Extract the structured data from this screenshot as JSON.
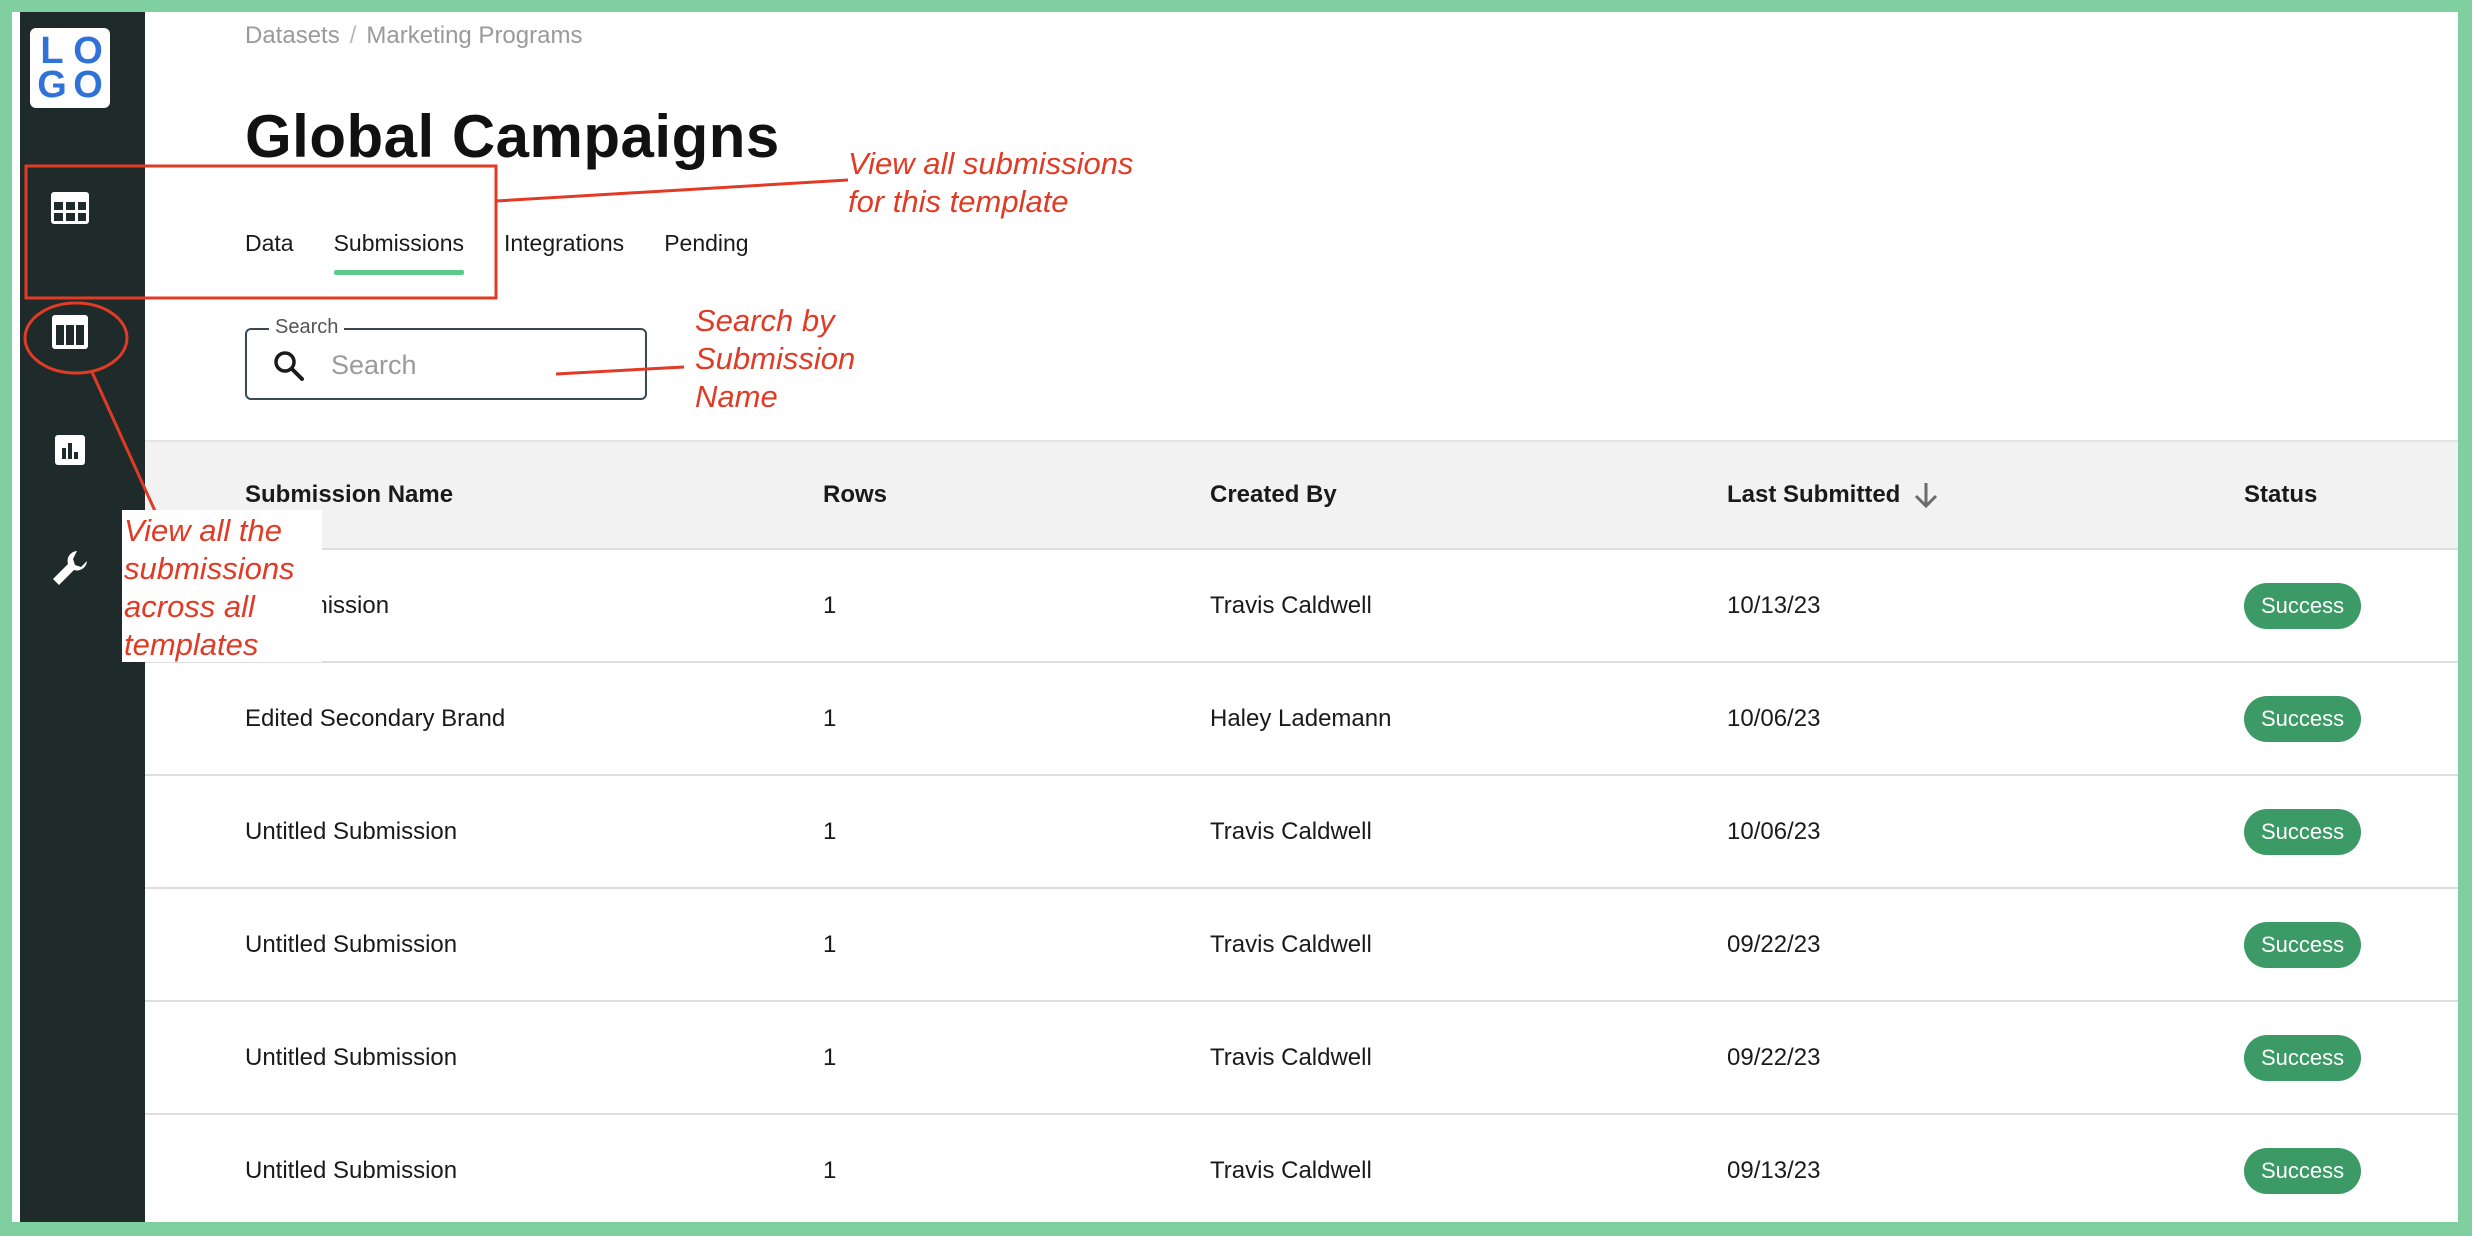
{
  "breadcrumb": {
    "items": [
      "Datasets",
      "Marketing Programs"
    ],
    "separator": "/"
  },
  "page_title": "Global Campaigns",
  "tabs": [
    {
      "label": "Data",
      "active": false
    },
    {
      "label": "Submissions",
      "active": true
    },
    {
      "label": "Integrations",
      "active": false
    },
    {
      "label": "Pending",
      "active": false
    }
  ],
  "search": {
    "label": "Search",
    "placeholder": "Search"
  },
  "table": {
    "headers": [
      "Submission Name",
      "Rows",
      "Created By",
      "Last Submitted",
      "Status"
    ],
    "sort_icon": "arrow-down-icon",
    "rows": [
      {
        "name": "d Submission",
        "rows": "1",
        "created_by": "Travis Caldwell",
        "last_submitted": "10/13/23",
        "status": "Success"
      },
      {
        "name": "Edited Secondary Brand",
        "rows": "1",
        "created_by": "Haley Lademann",
        "last_submitted": "10/06/23",
        "status": "Success"
      },
      {
        "name": "Untitled Submission",
        "rows": "1",
        "created_by": "Travis Caldwell",
        "last_submitted": "10/06/23",
        "status": "Success"
      },
      {
        "name": "Untitled Submission",
        "rows": "1",
        "created_by": "Travis Caldwell",
        "last_submitted": "09/22/23",
        "status": "Success"
      },
      {
        "name": "Untitled Submission",
        "rows": "1",
        "created_by": "Travis Caldwell",
        "last_submitted": "09/22/23",
        "status": "Success"
      },
      {
        "name": "Untitled Submission",
        "rows": "1",
        "created_by": "Travis Caldwell",
        "last_submitted": "09/13/23",
        "status": "Success"
      }
    ]
  },
  "sidebar": {
    "logo_letters": [
      "L",
      "O",
      "G",
      "O"
    ],
    "icons": [
      "table-icon",
      "template-icon",
      "chart-icon",
      "wrench-icon"
    ]
  },
  "annotations": {
    "tabs_note": [
      "View all submissions",
      "for this template"
    ],
    "search_note": [
      "Search by",
      "Submission",
      "Name"
    ],
    "sidebar_note": [
      "View all the",
      "submissions",
      "across all",
      "templates"
    ]
  },
  "colors": {
    "frame": "#7fcfa0",
    "sidebar": "#1f2b2b",
    "accent": "#5ec98a",
    "success_badge": "#3c9a66",
    "annotation": "#e13b26",
    "logo": "#2f73d8"
  }
}
